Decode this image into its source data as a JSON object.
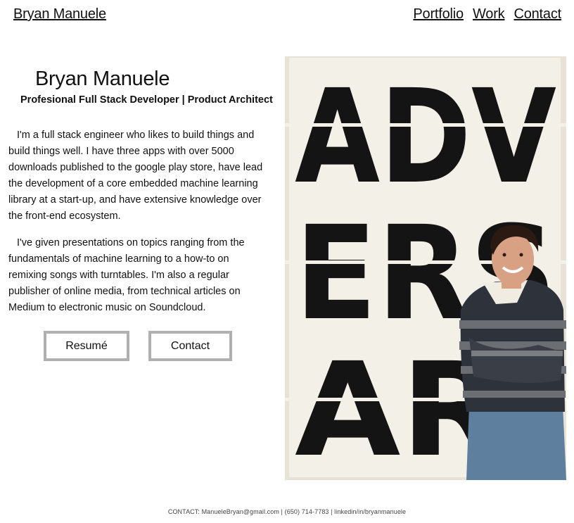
{
  "header": {
    "brand": "Bryan Manuele",
    "nav": {
      "portfolio": "Portfolio",
      "work": "Work",
      "contact": "Contact"
    }
  },
  "intro": {
    "name": "Bryan Manuele",
    "title": "Profesional Full Stack Developer | Product Architect",
    "paragraphs": [
      "I'm a full stack engineer who likes to build things and build things well. I have three apps with over 5000 downloads published to the google play store, have lead the development of a core embedded machine learning library at a start-up, and have extensive knowledge over the front-end ecosystem.",
      "I've given presentations on topics ranging from the fundamentals of machine learning to a how-to on remixing songs with turntables. I'm also a regular publisher of online media, from technical articles on Medium to electronic music on Soundcloud."
    ],
    "buttons": {
      "resume": "Resumé",
      "contact": "Contact"
    }
  },
  "photo": {
    "poster_lines": [
      "ADV",
      "ERS",
      "AR"
    ],
    "colors": {
      "wall": "#e8e2d6",
      "poster": "#f3f0e8",
      "ink": "#141414",
      "sweater_dark": "#2e333b",
      "sweater_stripe": "#6b6f74",
      "jeans": "#5f7f9e",
      "skin": "#d9a184",
      "hair": "#2a1a12"
    }
  },
  "footer": {
    "text": "CONTACT: ManueleBryan@gmail.com | (650) 714-7783 | linkedin/in/bryanmanuele"
  }
}
